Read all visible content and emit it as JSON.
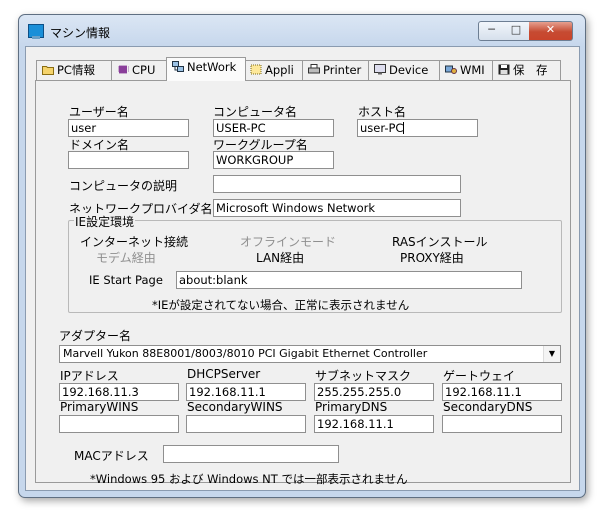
{
  "window": {
    "title": "マシン情報",
    "min_symbol": "─",
    "max_symbol": "□",
    "close_symbol": "✕"
  },
  "tabs": [
    {
      "label": "PC情報",
      "icon": "folder-icon"
    },
    {
      "label": "CPU",
      "icon": "chip-icon"
    },
    {
      "label": "NetWork",
      "icon": "network-icon",
      "active": true
    },
    {
      "label": "Appli",
      "icon": "app-icon"
    },
    {
      "label": "Printer",
      "icon": "printer-icon"
    },
    {
      "label": "Device",
      "icon": "device-icon"
    },
    {
      "label": "WMI",
      "icon": "wmi-icon"
    },
    {
      "label": "保　存",
      "icon": "floppy-disk-icon"
    }
  ],
  "network": {
    "user_label": "ユーザー名",
    "user_value": "user",
    "computer_label": "コンピュータ名",
    "computer_value": "USER-PC",
    "host_label": "ホスト名",
    "host_value": "user-PC",
    "domain_label": "ドメイン名",
    "domain_value": "",
    "workgroup_label": "ワークグループ名",
    "workgroup_value": "WORKGROUP",
    "description_label": "コンピュータの説明",
    "description_value": "",
    "provider_label": "ネットワークプロバイダ名",
    "provider_value": "Microsoft Windows Network"
  },
  "ie": {
    "group_title": "IE設定環境",
    "internet_connect": "インターネット接続",
    "offline_mode": "オフラインモード",
    "ras_install": "RASインストール",
    "modem": "モデム経由",
    "lan": "LAN経由",
    "proxy": "PROXY経由",
    "start_page_label": "IE Start Page",
    "start_page_value": "about:blank",
    "note": "*IEが設定されてない場合、正常に表示されません"
  },
  "adapter": {
    "label": "アダプター名",
    "selected": "Marvell Yukon 88E8001/8003/8010 PCI Gigabit Ethernet Controller",
    "ip_label": "IPアドレス",
    "ip_value": "192.168.11.3",
    "dhcp_label": "DHCPServer",
    "dhcp_value": "192.168.11.1",
    "subnet_label": "サブネットマスク",
    "subnet_value": "255.255.255.0",
    "gateway_label": "ゲートウェイ",
    "gateway_value": "192.168.11.1",
    "pwins_label": "PrimaryWINS",
    "pwins_value": "",
    "swins_label": "SecondaryWINS",
    "swins_value": "",
    "pdns_label": "PrimaryDNS",
    "pdns_value": "192.168.11.1",
    "sdns_label": "SecondaryDNS",
    "sdns_value": "",
    "mac_label": "MACアドレス",
    "mac_value": "",
    "note": "*Windows 95 および Windows NT では一部表示されません"
  }
}
